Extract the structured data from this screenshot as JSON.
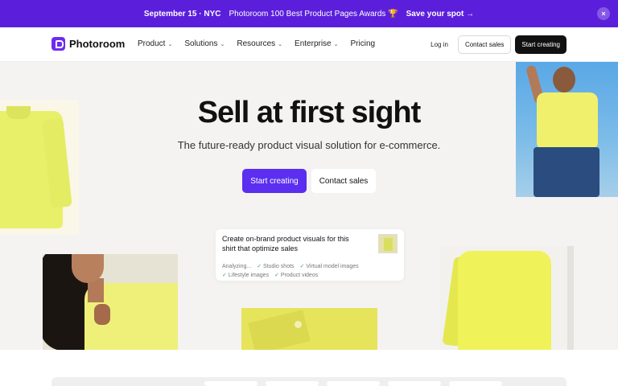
{
  "banner": {
    "date": "September 15 · NYC",
    "award": "Photoroom 100 Best Product Pages Awards 🏆",
    "cta": "Save your spot →",
    "close_icon": "×"
  },
  "nav": {
    "logo_text": "Photoroom",
    "menu": [
      "Product",
      "Solutions",
      "Resources",
      "Enterprise",
      "Pricing"
    ],
    "login": "Log in",
    "contact": "Contact sales",
    "start": "Start creating"
  },
  "hero": {
    "title": "Sell at first sight",
    "subtitle": "The future-ready product visual solution for e-commerce.",
    "primary_cta": "Start creating",
    "secondary_cta": "Contact sales"
  },
  "prompt_card": {
    "text": "Create on-brand product visuals for this shirt that optimize sales",
    "status": "Analyzing...",
    "checks": [
      "Studio shots",
      "Virtual model images",
      "Lifestyle images",
      "Product videos"
    ]
  },
  "colors": {
    "brand": "#5b1fdc",
    "primary_button": "#5b2ef0",
    "hero_bg": "#f4f3f1"
  }
}
